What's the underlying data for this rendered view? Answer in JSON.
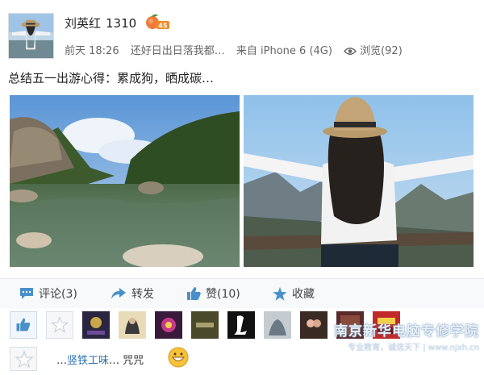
{
  "user": {
    "name": "刘英红",
    "number": "1310",
    "badge": "45"
  },
  "meta": {
    "time": "前天 18:26",
    "title": "还好日出日落我都…",
    "source": "来自 iPhone 6 (4G)",
    "views": "浏览(92)"
  },
  "post_text": "总结五一出游心得：累成狗，晒成碳…",
  "actions": {
    "comment": "评论(3)",
    "share": "转发",
    "like": "赞(10)",
    "favorite": "收藏"
  },
  "watermark": {
    "line1": "南京新华电脑专修学院",
    "line2": "专业教育，诚信天下 | www.njxh.cn"
  },
  "comment": {
    "prefix": "…",
    "link": "竖铁",
    "middle": "工味",
    "suffix": "… 咒咒"
  },
  "gift_icons": [
    "thumb-up-icon",
    "star-icon",
    "gift-1",
    "gift-2",
    "gift-3",
    "gift-4",
    "gift-5",
    "gift-6",
    "gift-7",
    "gift-8",
    "gift-9"
  ],
  "colors": {
    "accent": "#2a6db0",
    "action_icon": "#4a90c8"
  }
}
